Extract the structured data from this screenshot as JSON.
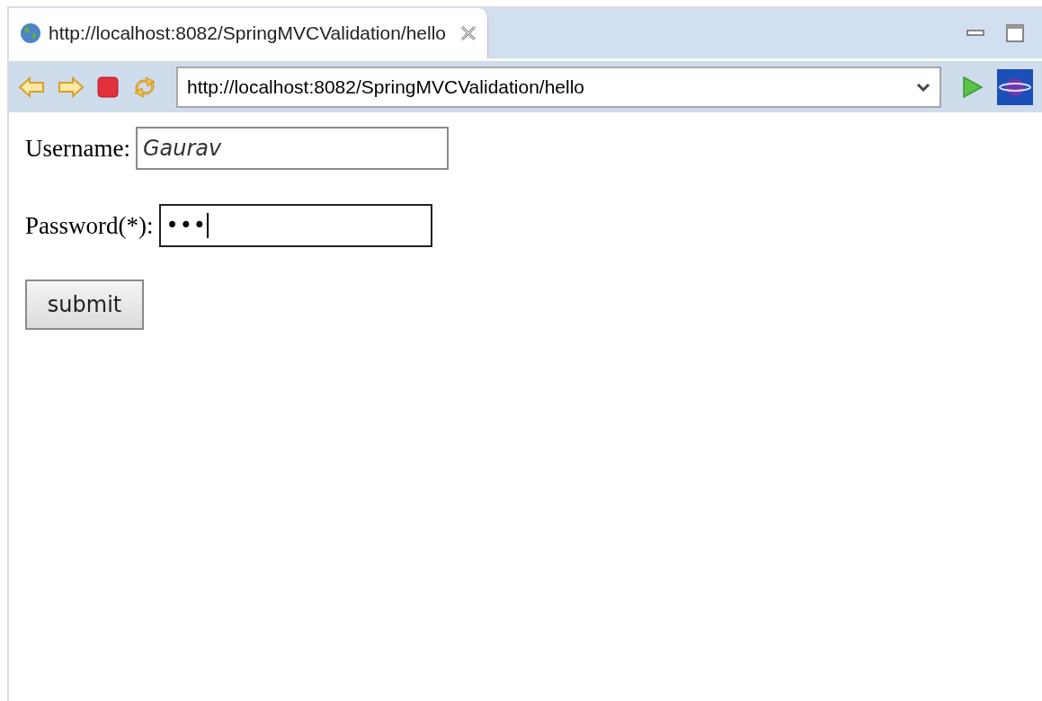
{
  "tab": {
    "title": "http://localhost:8082/SpringMVCValidation/hello",
    "selected": true
  },
  "address_bar": {
    "value": "http://localhost:8082/SpringMVCValidation/hello"
  },
  "form": {
    "fields": [
      {
        "label": "Username:",
        "value": "Gaurav",
        "kind": "text",
        "focused": false
      },
      {
        "label": "Password(*):",
        "value": "•••",
        "kind": "password",
        "focused": true
      }
    ],
    "submit": "submit"
  }
}
